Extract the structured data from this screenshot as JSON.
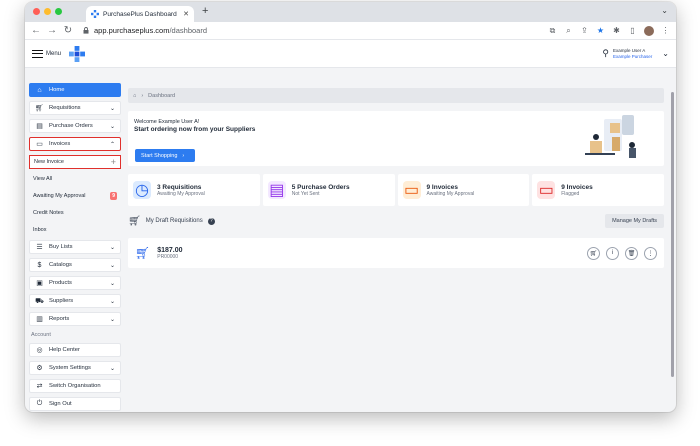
{
  "browser": {
    "tab_title": "PurchasePlus Dashboard",
    "url_domain": "app.purchaseplus.com",
    "url_path": "/dashboard"
  },
  "header": {
    "menu_label": "Menu",
    "user_name": "Example User A",
    "user_role": "Example Purchaser"
  },
  "sidebar": {
    "items": [
      {
        "label": "Home"
      },
      {
        "label": "Requisitions"
      },
      {
        "label": "Purchase Orders"
      },
      {
        "label": "Invoices"
      }
    ],
    "sub_items": [
      {
        "label": "New Invoice"
      },
      {
        "label": "View All"
      },
      {
        "label": "Awaiting My Approval",
        "badge": "9"
      },
      {
        "label": "Credit Notes"
      },
      {
        "label": "Inbox"
      }
    ],
    "items2": [
      {
        "label": "Buy Lists"
      },
      {
        "label": "Catalogs"
      },
      {
        "label": "Products"
      },
      {
        "label": "Suppliers"
      },
      {
        "label": "Reports"
      }
    ],
    "account_label": "Account",
    "account_items": [
      {
        "label": "Help Center"
      },
      {
        "label": "System Settings"
      },
      {
        "label": "Switch Organisation"
      },
      {
        "label": "Sign Out"
      }
    ]
  },
  "breadcrumb": {
    "label": "Dashboard"
  },
  "welcome": {
    "greeting": "Welcome Example User A!",
    "headline": "Start ordering now from your Suppliers",
    "button": "Start Shopping"
  },
  "stats": [
    {
      "title": "3 Requisitions",
      "subtitle": "Awaiting My Approval"
    },
    {
      "title": "5 Purchase Orders",
      "subtitle": "Not Yet Sent"
    },
    {
      "title": "9 Invoices",
      "subtitle": "Awaiting My Approval"
    },
    {
      "title": "9 Invoices",
      "subtitle": "Flagged"
    }
  ],
  "drafts": {
    "title": "My Draft Requisitions",
    "manage_button": "Manage My Drafts",
    "items": [
      {
        "amount": "$187.00",
        "number": "PR00000"
      }
    ]
  },
  "colors": {
    "primary": "#2d7cf0",
    "highlight": "#e0302c"
  }
}
